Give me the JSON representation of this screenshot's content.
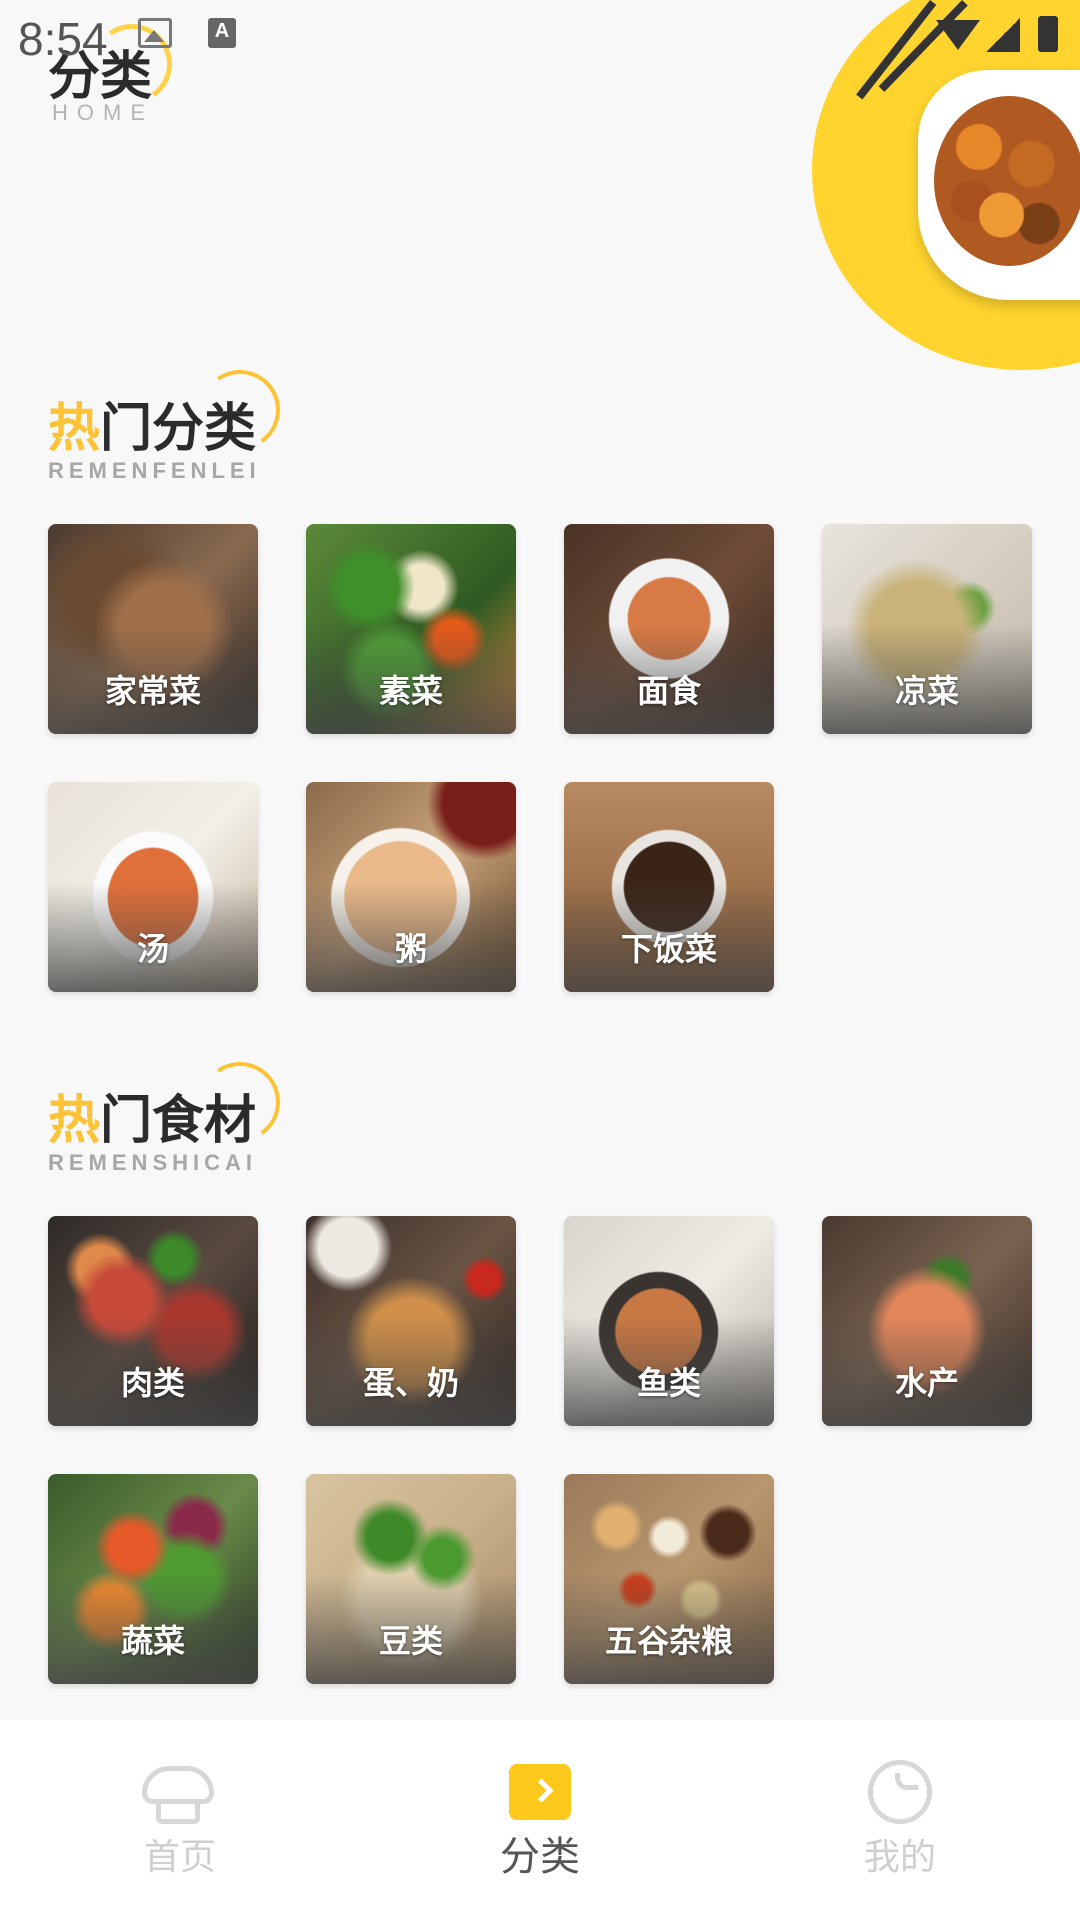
{
  "status_bar": {
    "time": "8:54"
  },
  "header": {
    "title": "分类",
    "subtitle": "HOME"
  },
  "sections": [
    {
      "title_accent": "热",
      "title_rest": "门分类",
      "subtitle": "REMENFENLEI",
      "items": [
        {
          "label": "家常菜"
        },
        {
          "label": "素菜"
        },
        {
          "label": "面食"
        },
        {
          "label": "凉菜"
        },
        {
          "label": "汤"
        },
        {
          "label": "粥"
        },
        {
          "label": "下饭菜"
        }
      ]
    },
    {
      "title_accent": "热",
      "title_rest": "门食材",
      "subtitle": "REMENSHICAI",
      "items": [
        {
          "label": "肉类"
        },
        {
          "label": "蛋、奶"
        },
        {
          "label": "鱼类"
        },
        {
          "label": "水产"
        },
        {
          "label": "蔬菜"
        },
        {
          "label": "豆类"
        },
        {
          "label": "五谷杂粮"
        }
      ]
    }
  ],
  "bottom_nav": [
    {
      "label": "首页",
      "icon": "chef-hat-icon",
      "active": false
    },
    {
      "label": "分类",
      "icon": "play-square-icon",
      "active": true
    },
    {
      "label": "我的",
      "icon": "smile-face-icon",
      "active": false
    }
  ],
  "colors": {
    "accent": "#fdc235",
    "hero": "#ffd42e",
    "nav_active_icon": "#fdc81c"
  }
}
